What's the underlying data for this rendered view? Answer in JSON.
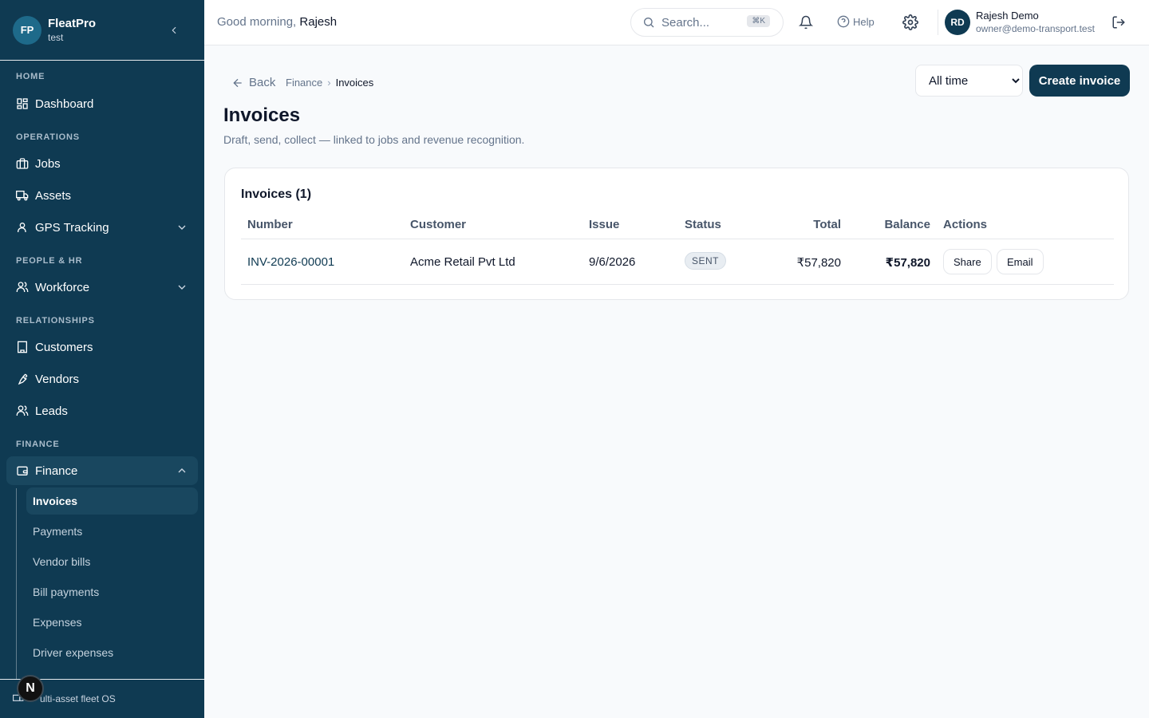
{
  "brand": {
    "initials": "FP",
    "name": "FleatPro",
    "tenant": "test"
  },
  "sidebar": {
    "sections": [
      "HOME",
      "OPERATIONS",
      "PEOPLE & HR",
      "RELATIONSHIPS",
      "FINANCE"
    ],
    "items": {
      "dashboard": "Dashboard",
      "jobs": "Jobs",
      "assets": "Assets",
      "gps": "GPS Tracking",
      "workforce": "Workforce",
      "customers": "Customers",
      "vendors": "Vendors",
      "leads": "Leads",
      "finance": "Finance"
    },
    "finance_sub": [
      "Invoices",
      "Payments",
      "Vendor bills",
      "Bill payments",
      "Expenses",
      "Driver expenses"
    ],
    "footer": "ulti-asset fleet OS",
    "n_badge": "N"
  },
  "header": {
    "greeting_prefix": "Good morning,",
    "greeting_name": "Rajesh",
    "search_placeholder": "Search...",
    "search_shortcut": "⌘K",
    "help": "Help",
    "user_initials": "RD",
    "user_name": "Rajesh Demo",
    "user_email": "owner@demo-transport.test"
  },
  "page": {
    "back": "Back",
    "breadcrumb": [
      "Finance",
      "Invoices"
    ],
    "range_options": [
      "All time"
    ],
    "create_label": "Create invoice",
    "title": "Invoices",
    "subtitle": "Draft, send, collect — linked to jobs and revenue recognition."
  },
  "table": {
    "title": "Invoices (1)",
    "headers": [
      "Number",
      "Customer",
      "Issue",
      "Status",
      "Total",
      "Balance",
      "Actions"
    ],
    "rows": [
      {
        "number": "INV-2026-00001",
        "customer": "Acme Retail Pvt Ltd",
        "issue": "9/6/2026",
        "status": "SENT",
        "total": "₹57,820",
        "balance": "₹57,820",
        "actions": [
          "Share",
          "Email"
        ]
      }
    ]
  },
  "colors": {
    "sidebar": "#0f3a52",
    "primary": "#0f3a52",
    "active": "#19475f"
  }
}
